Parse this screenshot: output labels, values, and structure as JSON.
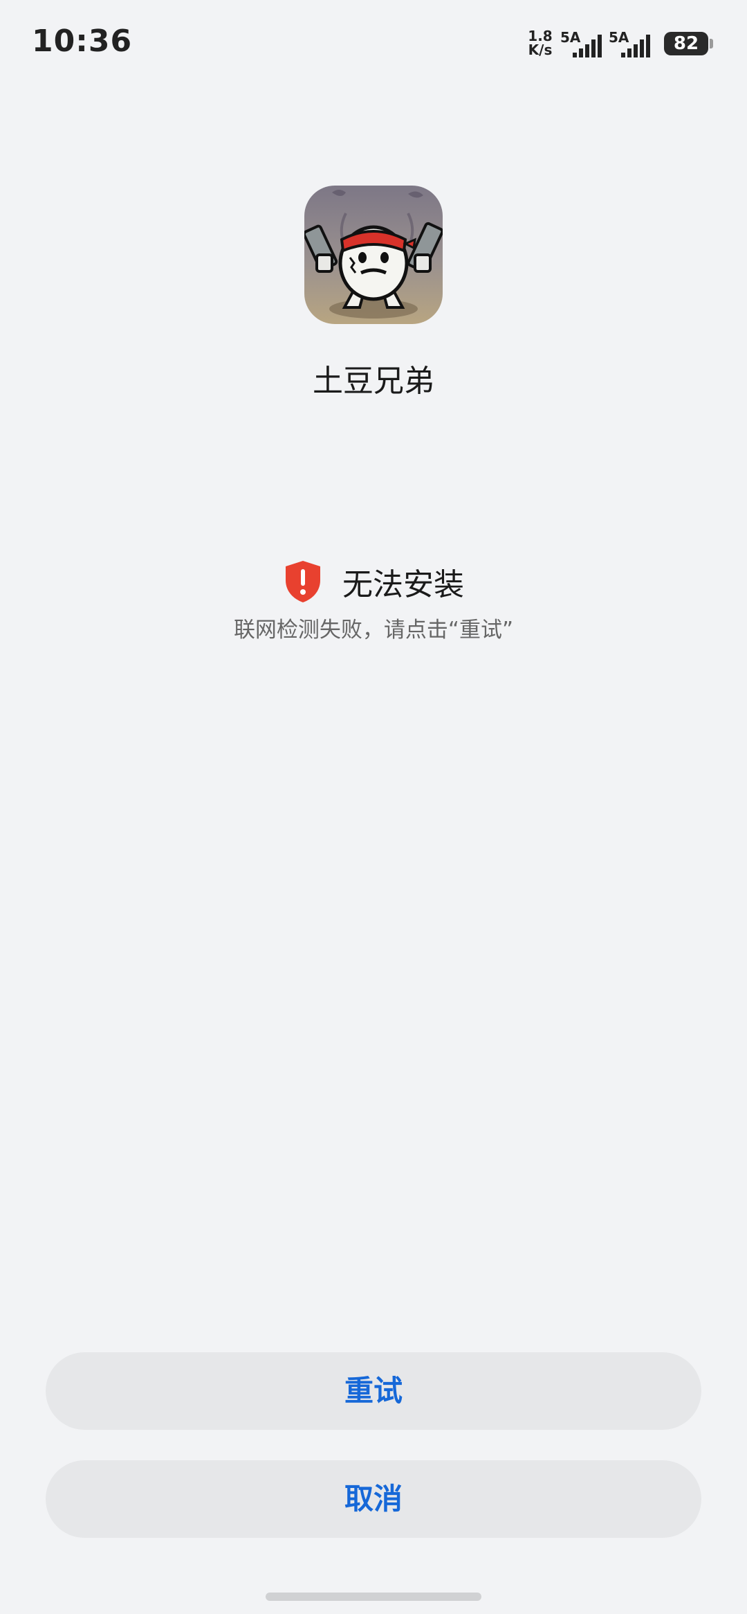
{
  "status_bar": {
    "time": "10:36",
    "net_speed_value": "1.8",
    "net_speed_unit": "K/s",
    "sim1_label": "5A",
    "sim2_label": "5A",
    "battery_level": "82"
  },
  "app": {
    "name": "土豆兄弟"
  },
  "error": {
    "title": "无法安装",
    "description": "联网检测失败，请点击“重试”"
  },
  "buttons": {
    "retry_label": "重试",
    "cancel_label": "取消"
  },
  "colors": {
    "background": "#f2f3f5",
    "accent": "#1668d8",
    "error_red": "#e8412f",
    "button_bg": "#e6e7e9"
  }
}
